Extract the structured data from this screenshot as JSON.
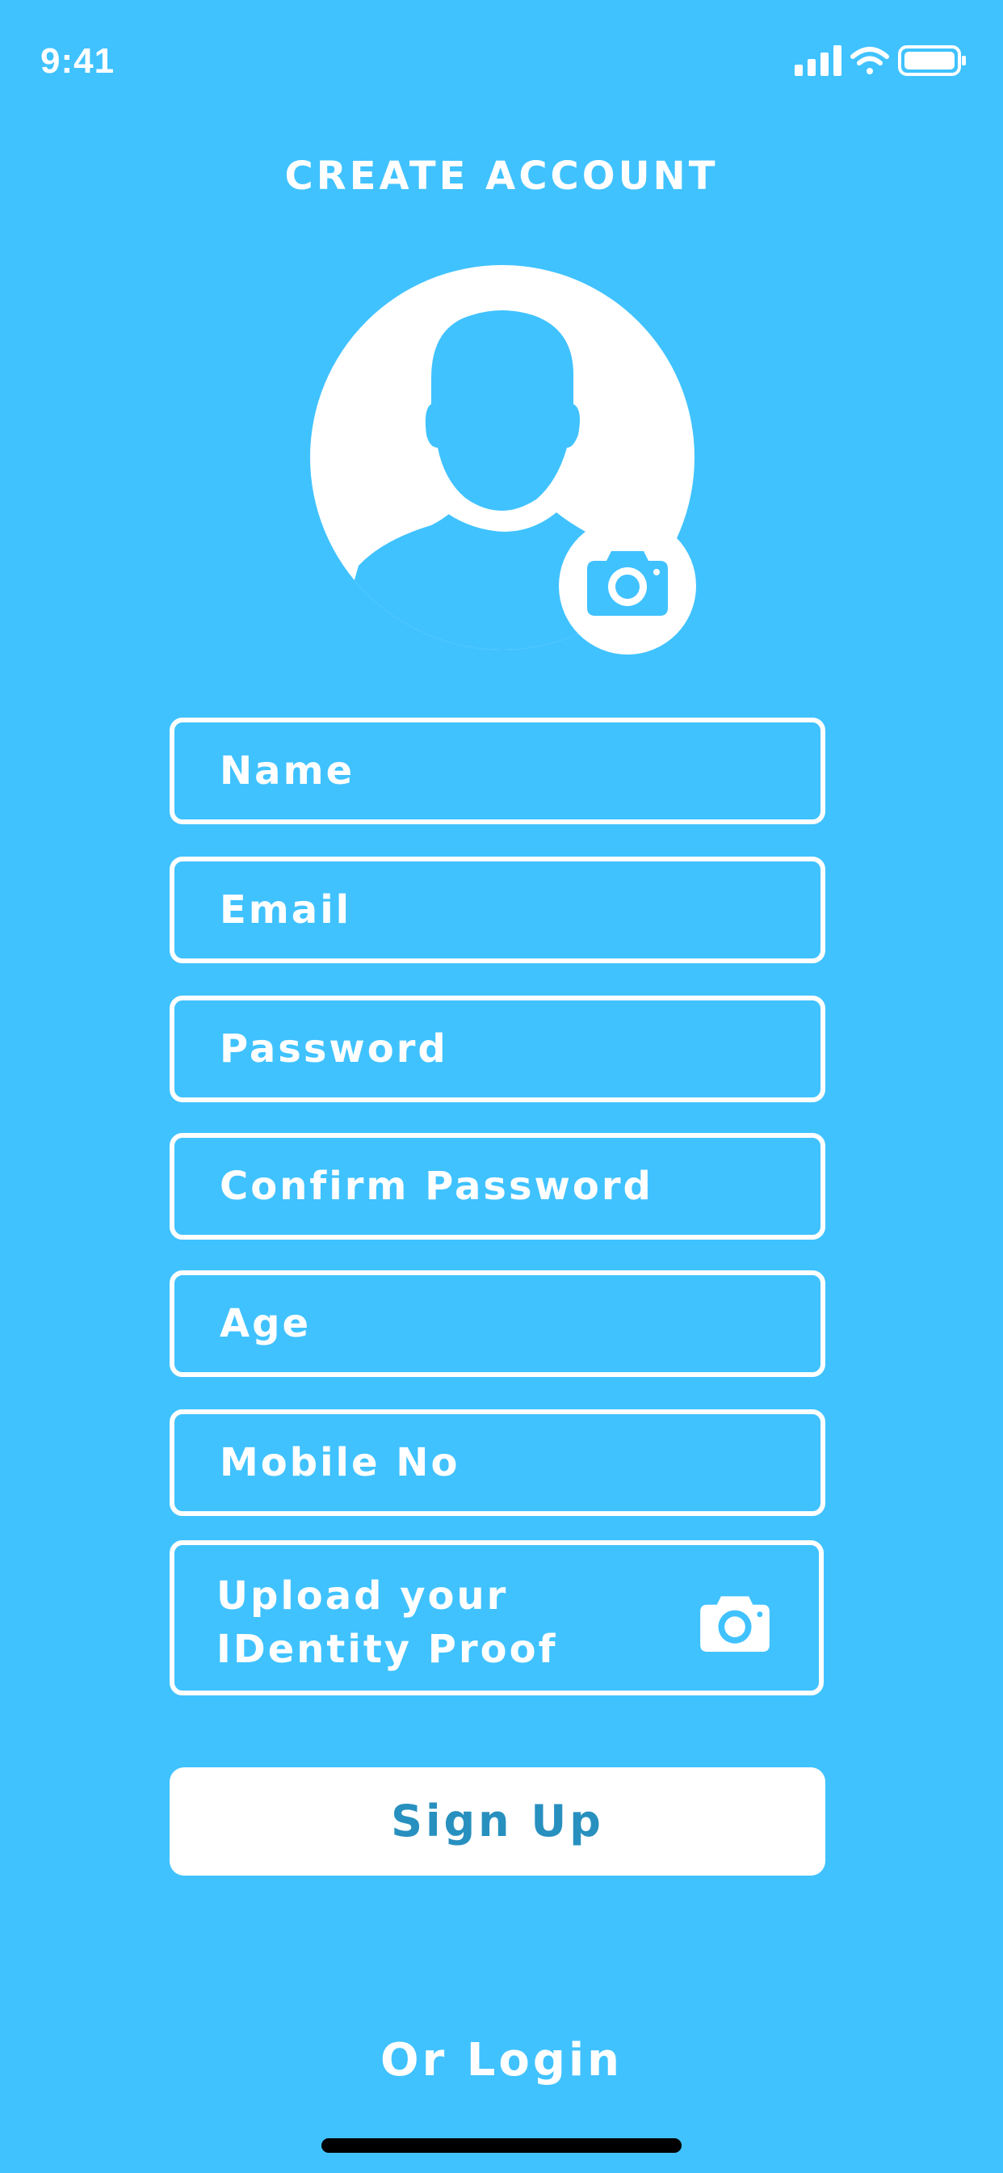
{
  "status_bar": {
    "time": "9:41",
    "icons": [
      "signal-icon",
      "wifi-icon",
      "battery-icon"
    ]
  },
  "header": {
    "title": "CREATE ACCOUNT"
  },
  "avatar": {
    "icon": "user-silhouette-icon",
    "camera_icon": "camera-icon"
  },
  "form": {
    "fields": [
      {
        "placeholder": "Name"
      },
      {
        "placeholder": "Email"
      },
      {
        "placeholder": "Password"
      },
      {
        "placeholder": "Confirm Password"
      },
      {
        "placeholder": "Age"
      },
      {
        "placeholder": "Mobile No"
      }
    ],
    "upload": {
      "line1": "Upload your",
      "line2": "IDentity Proof",
      "icon": "camera-icon"
    },
    "submit_label": "Sign Up"
  },
  "footer": {
    "login_label": "Or Login"
  },
  "colors": {
    "background": "#40c2ff",
    "foreground": "#ffffff",
    "button_text": "#2790bf"
  }
}
